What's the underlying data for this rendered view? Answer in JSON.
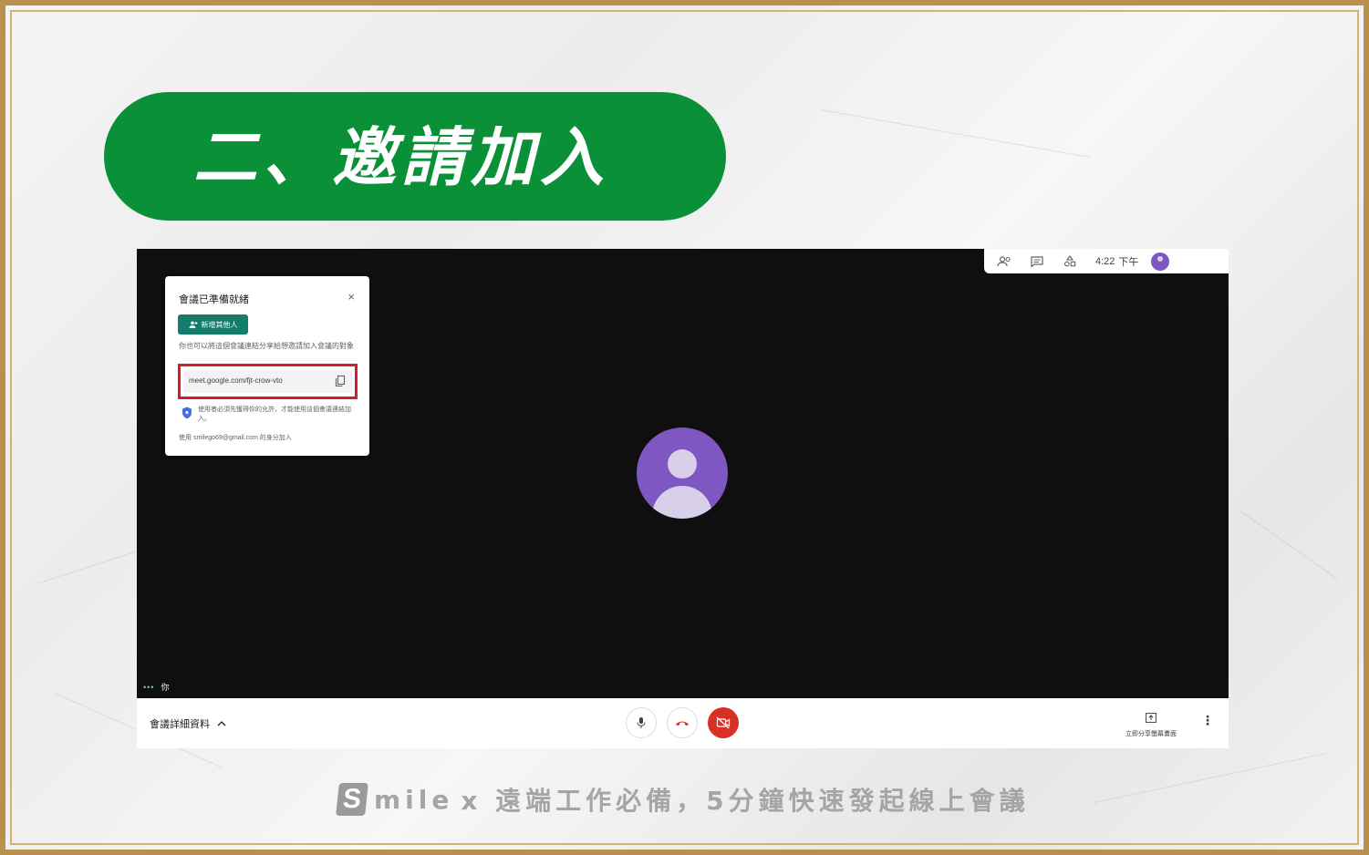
{
  "slide": {
    "title": "二、邀請加入",
    "footer_brand": "mile",
    "footer_text": "x 遠端工作必備，5分鐘快速發起線上會議",
    "colors": {
      "title_pill": "#0a9137",
      "frame_gold": "#b9914e"
    }
  },
  "meet": {
    "topbar": {
      "icons": [
        "people-icon",
        "chat-icon",
        "activities-icon"
      ],
      "time": "4:22",
      "time_suffix": "下午"
    },
    "dialog": {
      "title": "會議已準備就緒",
      "close_label": "×",
      "add_button_label": "新增其他人",
      "description": "你也可以將這個會議連結分享給想邀請加入會議的對象",
      "link": "meet.google.com/fjt-crow-vto",
      "note": "使用者必須先獲得你的允許，才能使用這個會議連結加入。",
      "footer": "使用 smilego69@gmail.com 的身分加入"
    },
    "self_label": "你",
    "bottombar": {
      "details_label": "會議詳細資料",
      "present_label": "立即分享螢幕畫面"
    },
    "colors": {
      "hangup": "#d93025",
      "avatar": "#7e57c2"
    }
  }
}
